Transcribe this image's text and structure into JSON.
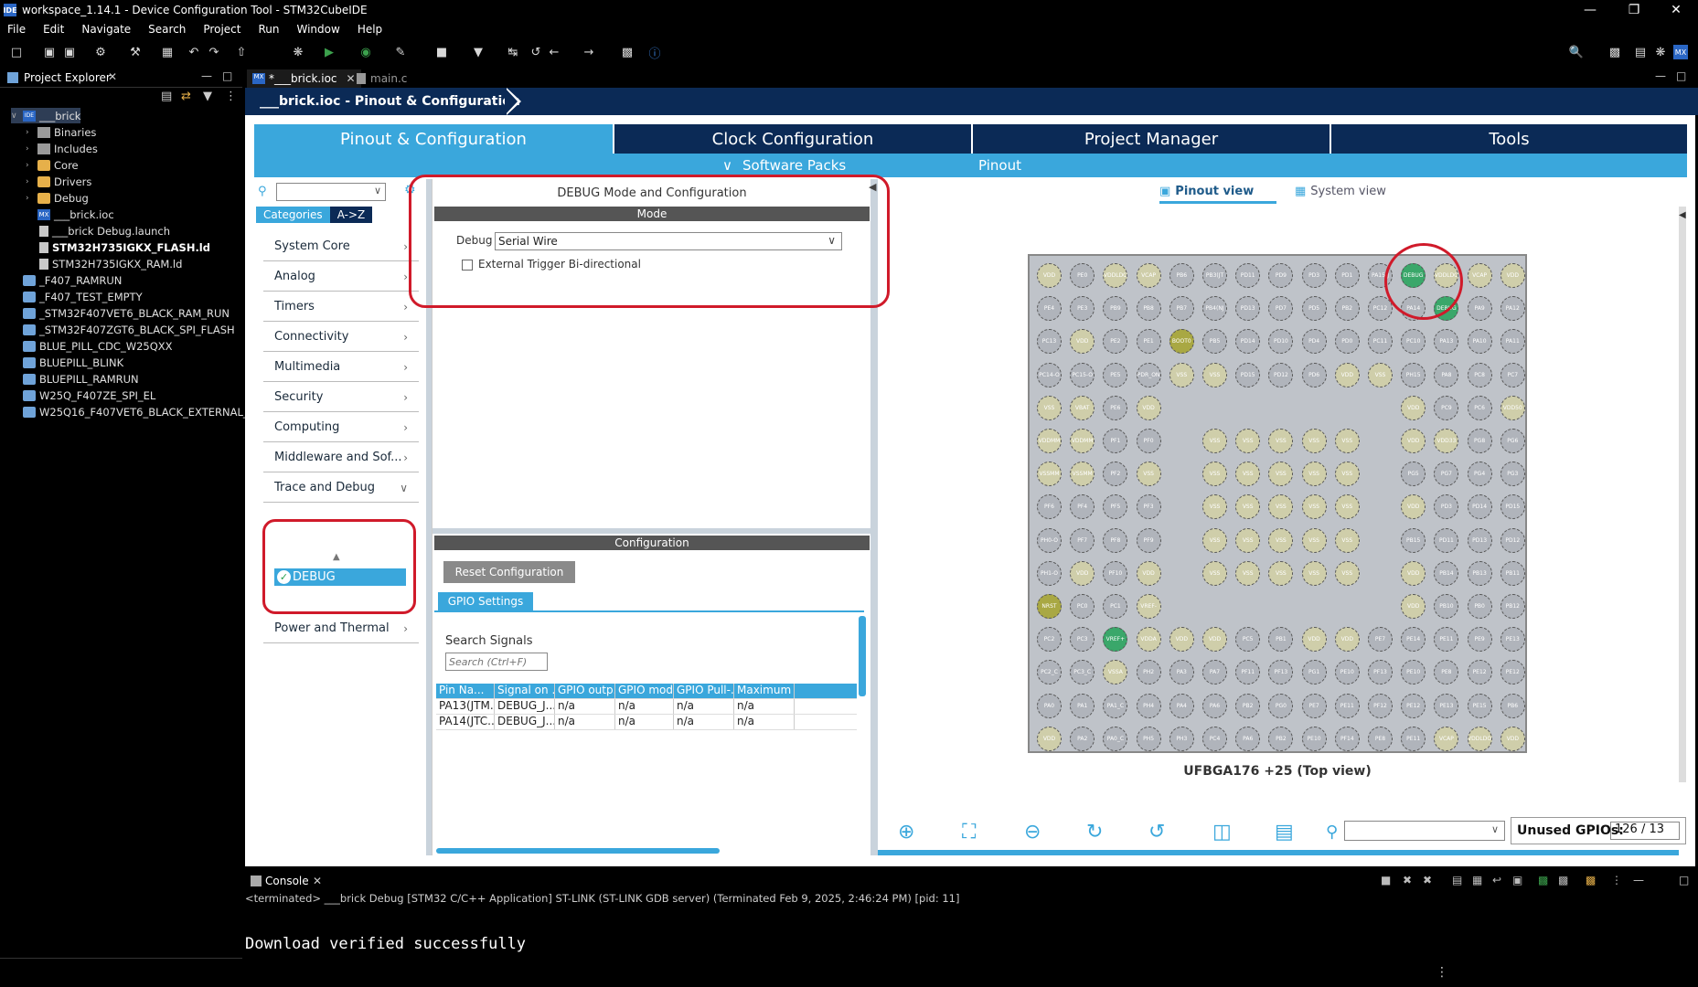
{
  "window": {
    "title": "workspace_1.14.1 - Device Configuration Tool - STM32CubeIDE",
    "app_icon": "IDE"
  },
  "menu": [
    "File",
    "Edit",
    "Navigate",
    "Search",
    "Project",
    "Run",
    "Window",
    "Help"
  ],
  "project_explorer": {
    "tab_label": "Project Explorer",
    "tree": [
      {
        "label": "___brick",
        "level": 0,
        "icon": "ide",
        "twisty": "v",
        "selected": true
      },
      {
        "label": "Binaries",
        "level": 1,
        "icon": "bin",
        "twisty": ">"
      },
      {
        "label": "Includes",
        "level": 1,
        "icon": "bin",
        "twisty": ">"
      },
      {
        "label": "Core",
        "level": 1,
        "icon": "folder",
        "twisty": ">"
      },
      {
        "label": "Drivers",
        "level": 1,
        "icon": "folder",
        "twisty": ">"
      },
      {
        "label": "Debug",
        "level": 1,
        "icon": "folder",
        "twisty": ">"
      },
      {
        "label": "___brick.ioc",
        "level": 1,
        "icon": "mx",
        "twisty": ""
      },
      {
        "label": "___brick Debug.launch",
        "level": 1,
        "icon": "file",
        "twisty": ""
      },
      {
        "label": "STM32H735IGKX_FLASH.ld",
        "level": 1,
        "icon": "file",
        "twisty": "",
        "bold": true
      },
      {
        "label": "STM32H735IGKX_RAM.ld",
        "level": 1,
        "icon": "file",
        "twisty": ""
      },
      {
        "label": "_F407_RAMRUN",
        "level": 0,
        "icon": "pfolder",
        "twisty": ""
      },
      {
        "label": "_F407_TEST_EMPTY",
        "level": 0,
        "icon": "pfolder",
        "twisty": ""
      },
      {
        "label": "_STM32F407VET6_BLACK_RAM_RUN",
        "level": 0,
        "icon": "pfolder",
        "twisty": ""
      },
      {
        "label": "_STM32F407ZGT6_BLACK_SPI_FLASH",
        "level": 0,
        "icon": "pfolder",
        "twisty": ""
      },
      {
        "label": "BLUE_PILL_CDC_W25QXX",
        "level": 0,
        "icon": "pfolder",
        "twisty": ""
      },
      {
        "label": "BLUEPILL_BLINK",
        "level": 0,
        "icon": "pfolder",
        "twisty": ""
      },
      {
        "label": "BLUEPILL_RAMRUN",
        "level": 0,
        "icon": "pfolder",
        "twisty": ""
      },
      {
        "label": "W25Q_F407ZE_SPI_EL",
        "level": 0,
        "icon": "pfolder",
        "twisty": ""
      },
      {
        "label": "W25Q16_F407VET6_BLACK_EXTERNAL_LO...",
        "level": 0,
        "icon": "pfolder",
        "twisty": ""
      }
    ]
  },
  "editor": {
    "tabs": [
      {
        "label": "*___brick.ioc",
        "active": true
      },
      {
        "label": "main.c",
        "active": false
      }
    ],
    "breadcrumb": "___brick.ioc - Pinout & Configuration"
  },
  "main_tabs": [
    "Pinout & Configuration",
    "Clock Configuration",
    "Project Manager",
    "Tools"
  ],
  "sub_tabs": {
    "software_packs": "Software Packs",
    "pinout": "Pinout"
  },
  "categories": {
    "tabs": [
      "Categories",
      "A->Z"
    ],
    "items": [
      {
        "label": "System Core"
      },
      {
        "label": "Analog"
      },
      {
        "label": "Timers"
      },
      {
        "label": "Connectivity"
      },
      {
        "label": "Multimedia"
      },
      {
        "label": "Security"
      },
      {
        "label": "Computing"
      },
      {
        "label": "Middleware and Sof..."
      },
      {
        "label": "Trace and Debug",
        "expanded": true
      },
      {
        "label": "Power and Thermal"
      }
    ],
    "selected_child": "DEBUG"
  },
  "mode_panel": {
    "title": "DEBUG Mode and Configuration",
    "mode_header": "Mode",
    "debug_label": "Debug",
    "debug_value": "Serial Wire",
    "ext_trigger_label": "External Trigger Bi-directional",
    "config_header": "Configuration",
    "reset_btn": "Reset Configuration",
    "gpio_tab": "GPIO Settings",
    "search_label": "Search Signals",
    "search_placeholder": "Search (Ctrl+F)",
    "table": {
      "headers": [
        "Pin Na...",
        "Signal on ...",
        "GPIO outp...",
        "GPIO mode",
        "GPIO Pull-...",
        "Maximum ..."
      ],
      "rows": [
        [
          "PA13(JTM...",
          "DEBUG_J...",
          "n/a",
          "n/a",
          "n/a",
          "n/a"
        ],
        [
          "PA14(JTC...",
          "DEBUG_J...",
          "n/a",
          "n/a",
          "n/a",
          "n/a"
        ]
      ]
    }
  },
  "pinout": {
    "view_tabs": [
      "Pinout view",
      "System view"
    ],
    "package_label": "UFBGA176 +25 (Top view)",
    "unused_label": "Unused GPIOs:",
    "unused_value": "126 / 13",
    "grid_rows": [
      [
        "VDD",
        "PE0",
        "VDDLDO",
        "VCAP",
        "PB6",
        "PB3(JT",
        "PD11",
        "PD9",
        "PD3",
        "PD1",
        "PA15(J",
        "DEBUG",
        "VDDLDO",
        "VCAP",
        "VDD"
      ],
      [
        "PE4",
        "PE3",
        "PB9",
        "PB8",
        "PB7",
        "PB4(NJ",
        "PD13",
        "PD7",
        "PD5",
        "PB2",
        "PC12",
        "PA14",
        "DEBUG",
        "PA9",
        "PA12"
      ],
      [
        "PC13",
        "VDD",
        "PE2",
        "PE1",
        "BOOT0",
        "PB5",
        "PD14",
        "PD10",
        "PD4",
        "PD0",
        "PC11",
        "PC10",
        "PA13",
        "PA10",
        "PA11"
      ],
      [
        "PC14-O",
        "PC15-O",
        "PE5",
        "PDR_ON",
        "VSS",
        "VSS",
        "PD15",
        "PD12",
        "PD6",
        "VDD",
        "VSS",
        "PH15",
        "PA8",
        "PC8",
        "PC7"
      ],
      [
        "VSS",
        "VBAT",
        "PE6",
        "VDD",
        "",
        "",
        "",
        "",
        "",
        "",
        "",
        "VDD",
        "PC9",
        "PC6",
        "VDD50"
      ],
      [
        "VDDMM",
        "VDDMM",
        "PF1",
        "PF0",
        "",
        "VSS",
        "VSS",
        "VSS",
        "VSS",
        "VSS",
        "",
        "VDD",
        "VDD33",
        "PG8",
        "PG6"
      ],
      [
        "VSSMM",
        "VSSMM",
        "PF2",
        "VSS",
        "",
        "VSS",
        "VSS",
        "VSS",
        "VSS",
        "VSS",
        "",
        "PG5",
        "PG7",
        "PG4",
        "PG3"
      ],
      [
        "PF6",
        "PF4",
        "PF5",
        "PF3",
        "",
        "VSS",
        "VSS",
        "VSS",
        "VSS",
        "VSS",
        "",
        "VDD",
        "PD3",
        "PD14",
        "PD15"
      ],
      [
        "PH0-O",
        "PF7",
        "PF8",
        "PF9",
        "",
        "VSS",
        "VSS",
        "VSS",
        "VSS",
        "VSS",
        "",
        "PB15",
        "PD11",
        "PD13",
        "PD12"
      ],
      [
        "PH1-O",
        "VDD",
        "PF10",
        "VDD",
        "",
        "VSS",
        "VSS",
        "VSS",
        "VSS",
        "VSS",
        "",
        "VDD",
        "PB14",
        "PB13",
        "PB11"
      ],
      [
        "NRST",
        "PC0",
        "PC1",
        "VREF-",
        "",
        "",
        "",
        "",
        "",
        "",
        "",
        "VDD",
        "PB10",
        "PB0",
        "PB12"
      ],
      [
        "PC2",
        "PC3",
        "VREF+",
        "VDDA",
        "VDD",
        "VDD",
        "PC5",
        "PB1",
        "VDD",
        "VDD",
        "PE7",
        "PE14",
        "PE11",
        "PE9",
        "PE13"
      ],
      [
        "PC2_C",
        "PC3_C",
        "VSSA",
        "PH2",
        "PA3",
        "PA7",
        "PF11",
        "PF13",
        "PG1",
        "PE10",
        "PF13",
        "PE10",
        "PE8",
        "PE12",
        "PE12"
      ],
      [
        "PA0",
        "PA1",
        "PA1_C",
        "PH4",
        "PA4",
        "PA6",
        "PB2",
        "PG0",
        "PE7",
        "PE11",
        "PF12",
        "PE12",
        "PE13",
        "PE15",
        "PB6"
      ],
      [
        "VDD",
        "PA2",
        "PA0_C",
        "PH5",
        "PH3",
        "PC4",
        "PA6",
        "PB2",
        "PE10",
        "PF14",
        "PE8",
        "PE11",
        "VCAP",
        "VDDLDO",
        "VDD"
      ]
    ]
  },
  "console": {
    "tab_label": "Console",
    "info": "<terminated> ___brick Debug [STM32 C/C++ Application] ST-LINK (ST-LINK GDB server) (Terminated Feb 9, 2025, 2:46:24 PM) [pid: 11]",
    "output": "Download verified successfully"
  },
  "colors": {
    "accent": "#3aa7dc",
    "dark_tab": "#0b2a56",
    "highlight": "#d01a2a",
    "pin_green": "#3aa76a"
  }
}
